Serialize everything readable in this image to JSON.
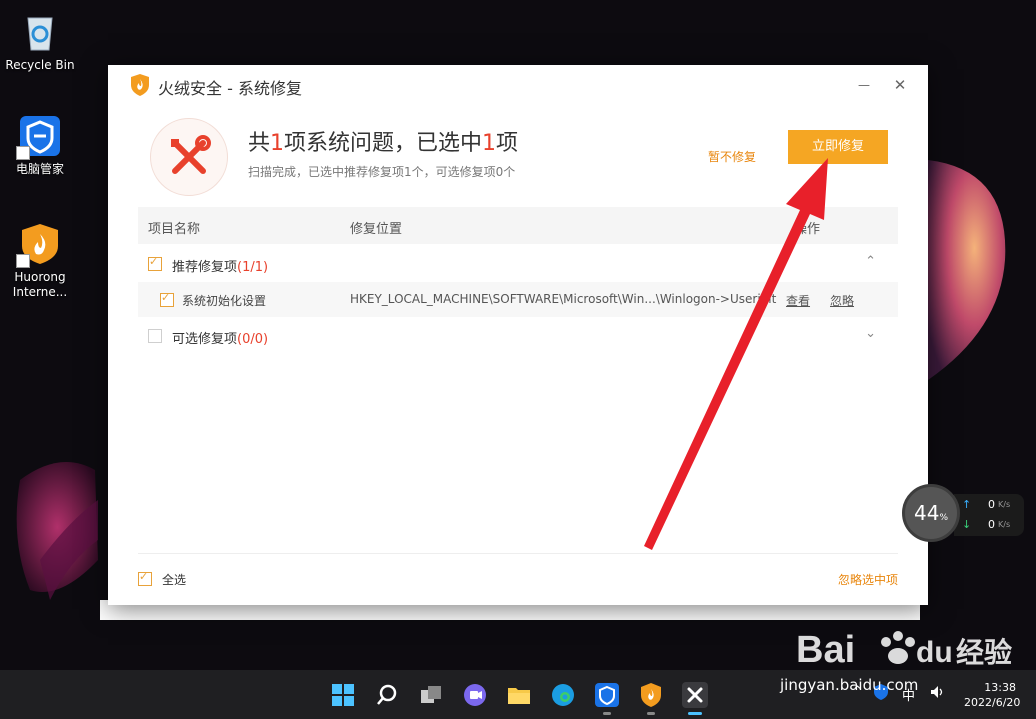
{
  "desktop": {
    "icons": [
      {
        "label": "Recycle Bin"
      },
      {
        "label": "电脑管家"
      },
      {
        "label": "Huorong Interne..."
      }
    ]
  },
  "window": {
    "title": "火绒安全 - 系统修复",
    "minimize": "—",
    "close": "✕",
    "headline_pre": "共",
    "headline_count1": "1",
    "headline_mid": "项系统问题，已选中",
    "headline_count2": "1",
    "headline_post": "项",
    "subline": "扫描完成，已选中推荐修复项1个，可选修复项0个",
    "skip_label": "暂不修复",
    "fix_label": "立即修复",
    "columns": [
      "项目名称",
      "修复位置",
      "操作"
    ],
    "groups": [
      {
        "label": "推荐修复项",
        "count": "(1/1)",
        "checked": true,
        "expanded": true
      },
      {
        "label": "可选修复项",
        "count": "(0/0)",
        "checked": false,
        "expanded": false
      }
    ],
    "item": {
      "name": "系统初始化设置",
      "path": "HKEY_LOCAL_MACHINE\\SOFTWARE\\Microsoft\\Win...\\Winlogon->Userinit",
      "view": "查看",
      "ignore": "忽略"
    },
    "select_all": "全选",
    "ignore_selected": "忽略选中项"
  },
  "net_widget": {
    "percent": "44",
    "percent_unit": "%",
    "up": "0",
    "down": "0",
    "unit": "K/s"
  },
  "taskbar": {
    "tray_ime": "中",
    "time": "13:38",
    "date": "2022/6/20"
  },
  "watermark": {
    "url": "jingyan.baidu.com"
  },
  "colors": {
    "accent_orange": "#f5a623",
    "highlight_red": "#e8412c",
    "arrow_red": "#e8202a"
  }
}
